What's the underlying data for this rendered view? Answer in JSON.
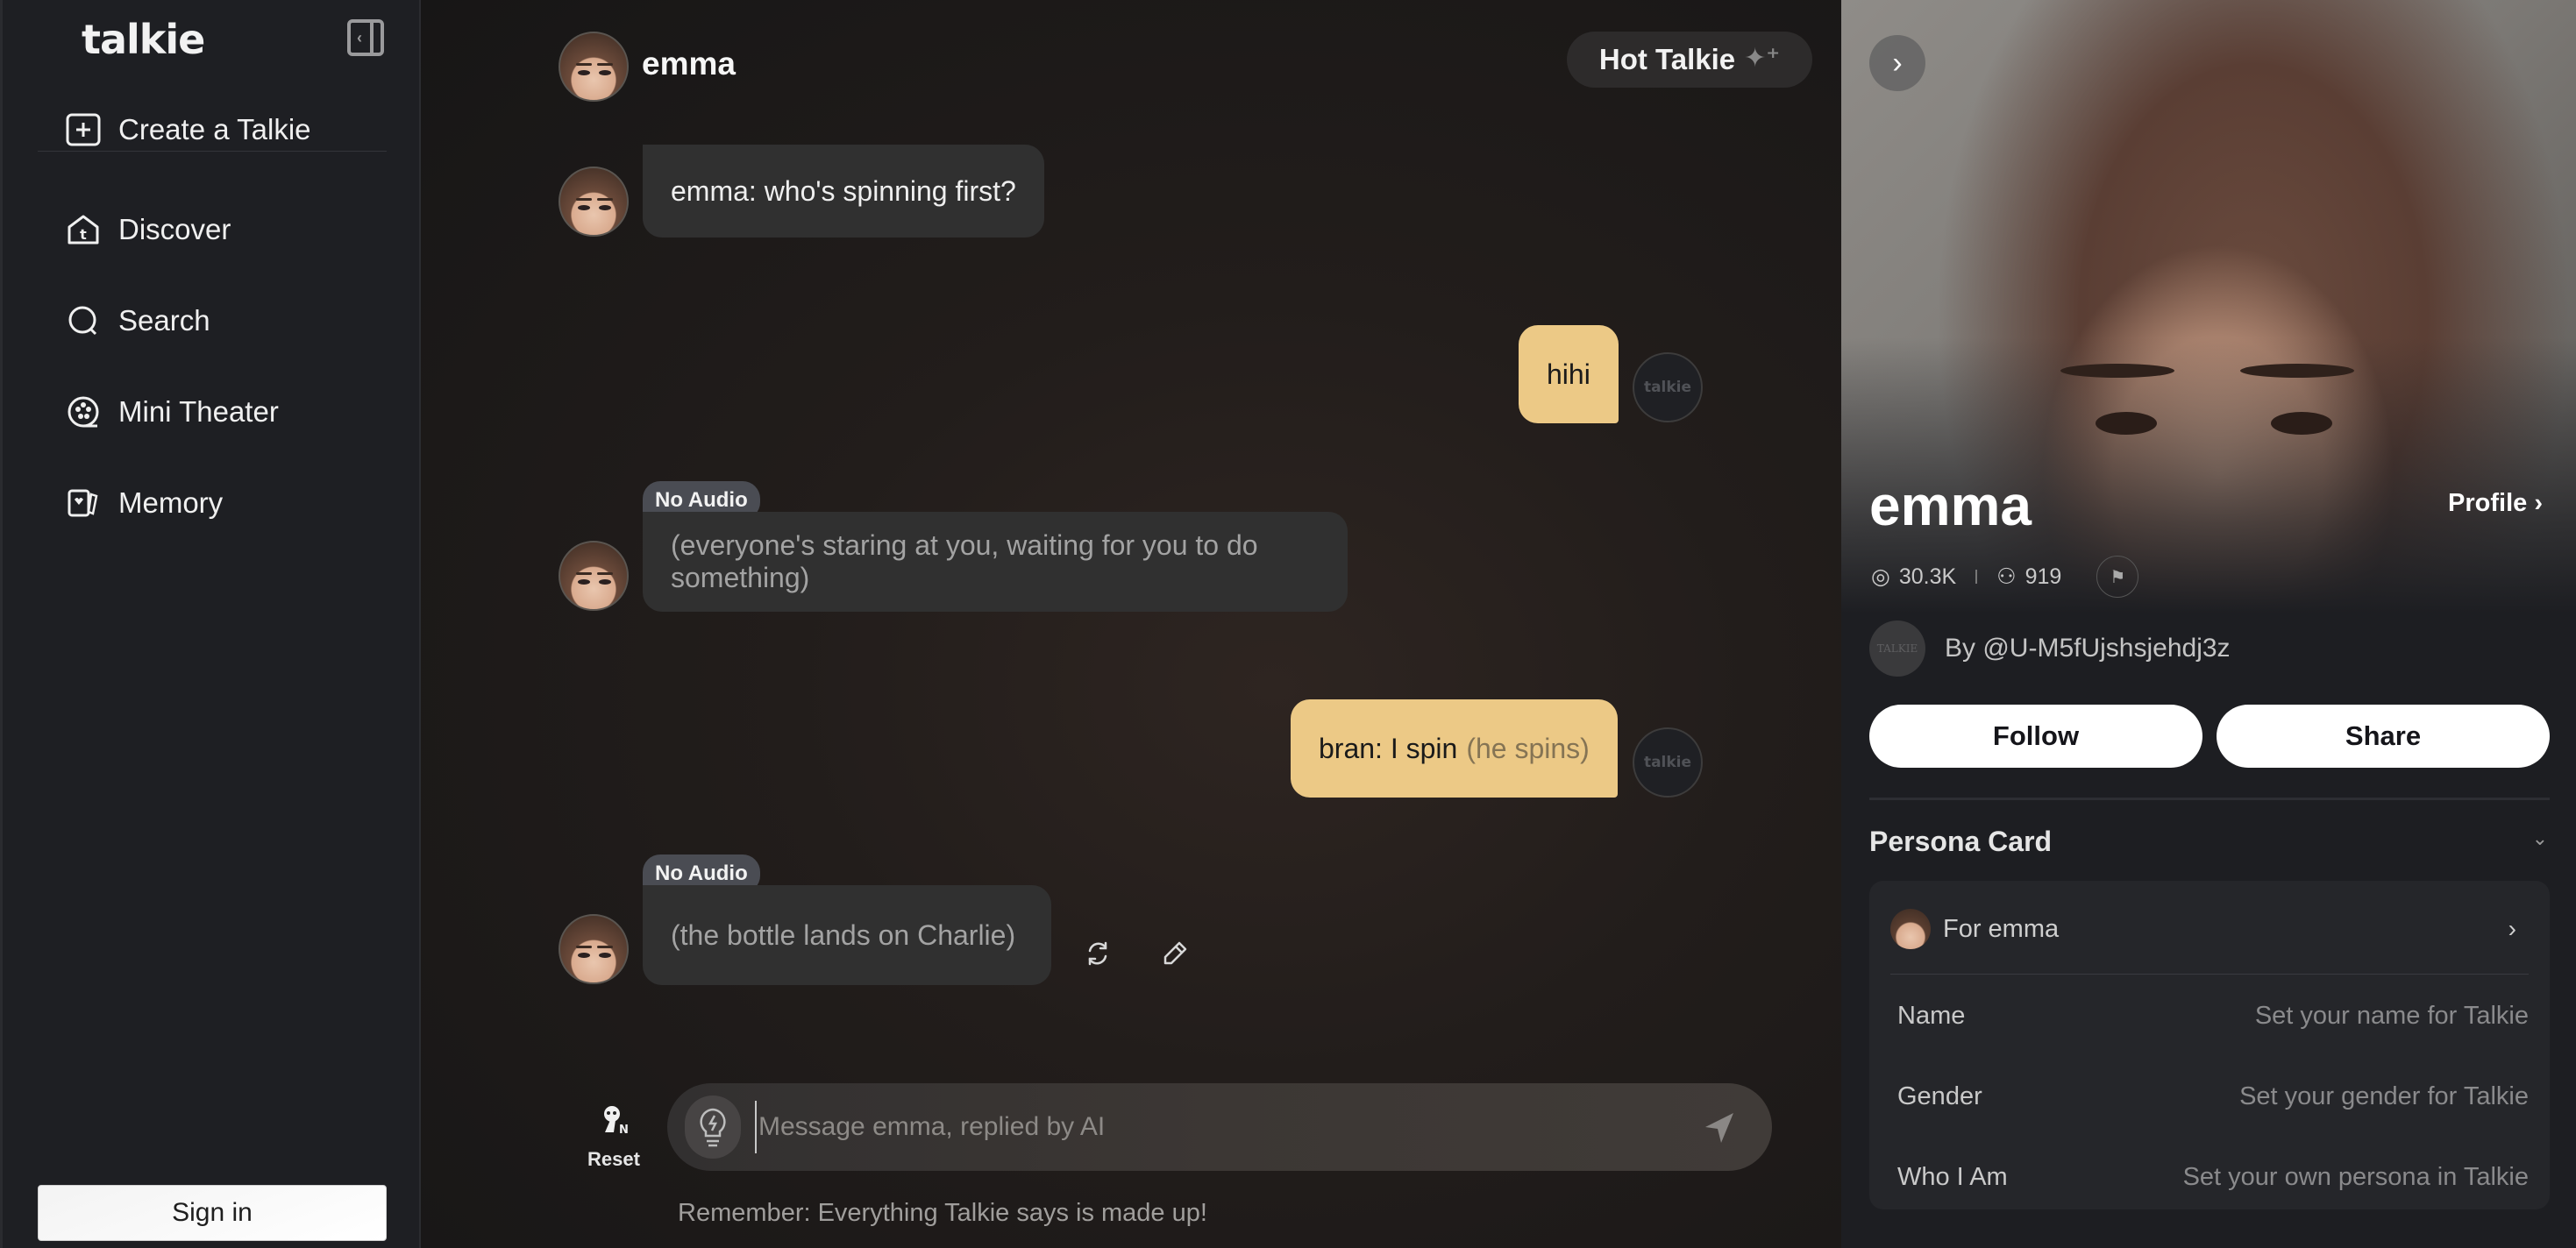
{
  "sidebar": {
    "logo": "talkie",
    "items": [
      {
        "label": "Create a Talkie",
        "icon": "plus-square-icon"
      },
      {
        "label": "Discover",
        "icon": "home-icon"
      },
      {
        "label": "Search",
        "icon": "search-icon"
      },
      {
        "label": "Mini Theater",
        "icon": "film-reel-icon"
      },
      {
        "label": "Memory",
        "icon": "memory-card-icon"
      }
    ],
    "sign_in_label": "Sign in"
  },
  "chat": {
    "character_name": "emma",
    "hot_talkie_label": "Hot Talkie",
    "messages": [
      {
        "role": "ai",
        "text": "emma: who's spinning first?",
        "tag": null
      },
      {
        "role": "user",
        "text": "hihi",
        "action": ""
      },
      {
        "role": "ai",
        "tag": "No Audio",
        "text": "(everyone's staring at you, waiting for you to do something)"
      },
      {
        "role": "user",
        "text": "bran: I spin",
        "action": "(he spins)"
      },
      {
        "role": "ai",
        "tag": "No Audio",
        "text": "(the bottle lands on Charlie)"
      }
    ],
    "user_avatar_text": "talkie",
    "reset_label": "Reset",
    "input": {
      "placeholder": "Message emma, replied by AI",
      "value": ""
    },
    "disclaimer": "Remember: Everything Talkie says is made up!"
  },
  "panel": {
    "name": "emma",
    "profile_label": "Profile",
    "stats": {
      "chats": "30.3K",
      "followers": "919"
    },
    "author": "By @U-M5fUjshsjehdj3z",
    "author_avatar_text": "TALKIE",
    "follow_label": "Follow",
    "share_label": "Share",
    "persona_card": {
      "title": "Persona Card",
      "for_label": "For emma",
      "rows": [
        {
          "key": "Name",
          "value": "Set your name for Talkie"
        },
        {
          "key": "Gender",
          "value": "Set your gender for Talkie"
        },
        {
          "key": "Who I Am",
          "value": "Set your own persona in Talkie"
        }
      ]
    }
  },
  "colors": {
    "user_bubble": "#ecc986",
    "ai_bubble": "#303030",
    "tag_bg": "#4a4c53",
    "sidebar_bg": "#1e1f23"
  }
}
